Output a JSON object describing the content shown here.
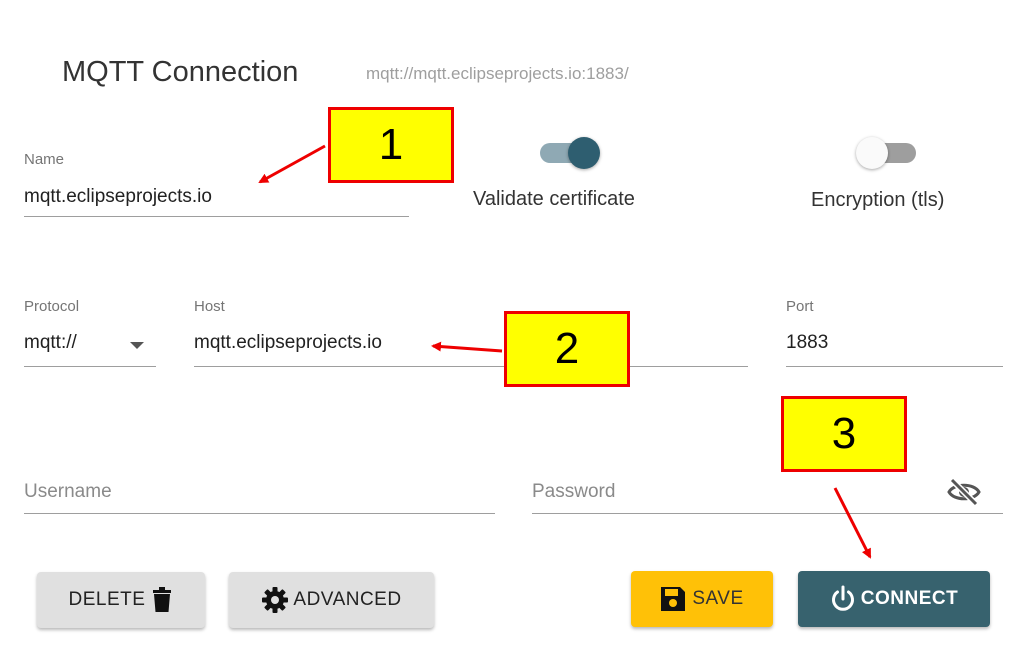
{
  "header": {
    "title": "MQTT Connection",
    "url": "mqtt://mqtt.eclipseprojects.io:1883/"
  },
  "form": {
    "name": {
      "label": "Name",
      "value": "mqtt.eclipseprojects.io"
    },
    "validate_certificate": {
      "label": "Validate certificate",
      "on": true
    },
    "encryption": {
      "label": "Encryption (tls)",
      "on": false
    },
    "protocol": {
      "label": "Protocol",
      "value": "mqtt://"
    },
    "host": {
      "label": "Host",
      "value": "mqtt.eclipseprojects.io"
    },
    "port": {
      "label": "Port",
      "value": "1883"
    },
    "username": {
      "placeholder": "Username"
    },
    "password": {
      "placeholder": "Password"
    }
  },
  "buttons": {
    "delete": "DELETE",
    "advanced": "ADVANCED",
    "save": "SAVE",
    "connect": "CONNECT"
  },
  "callouts": [
    "1",
    "2",
    "3"
  ],
  "colors": {
    "toggle_on_thumb": "#2e5e70",
    "toggle_on_track": "#8fa9b4",
    "save_bg": "#ffc107",
    "connect_bg": "#37626e",
    "callout_bg": "#ffff00",
    "callout_border": "#ee0000",
    "arrow": "#ee0000"
  }
}
